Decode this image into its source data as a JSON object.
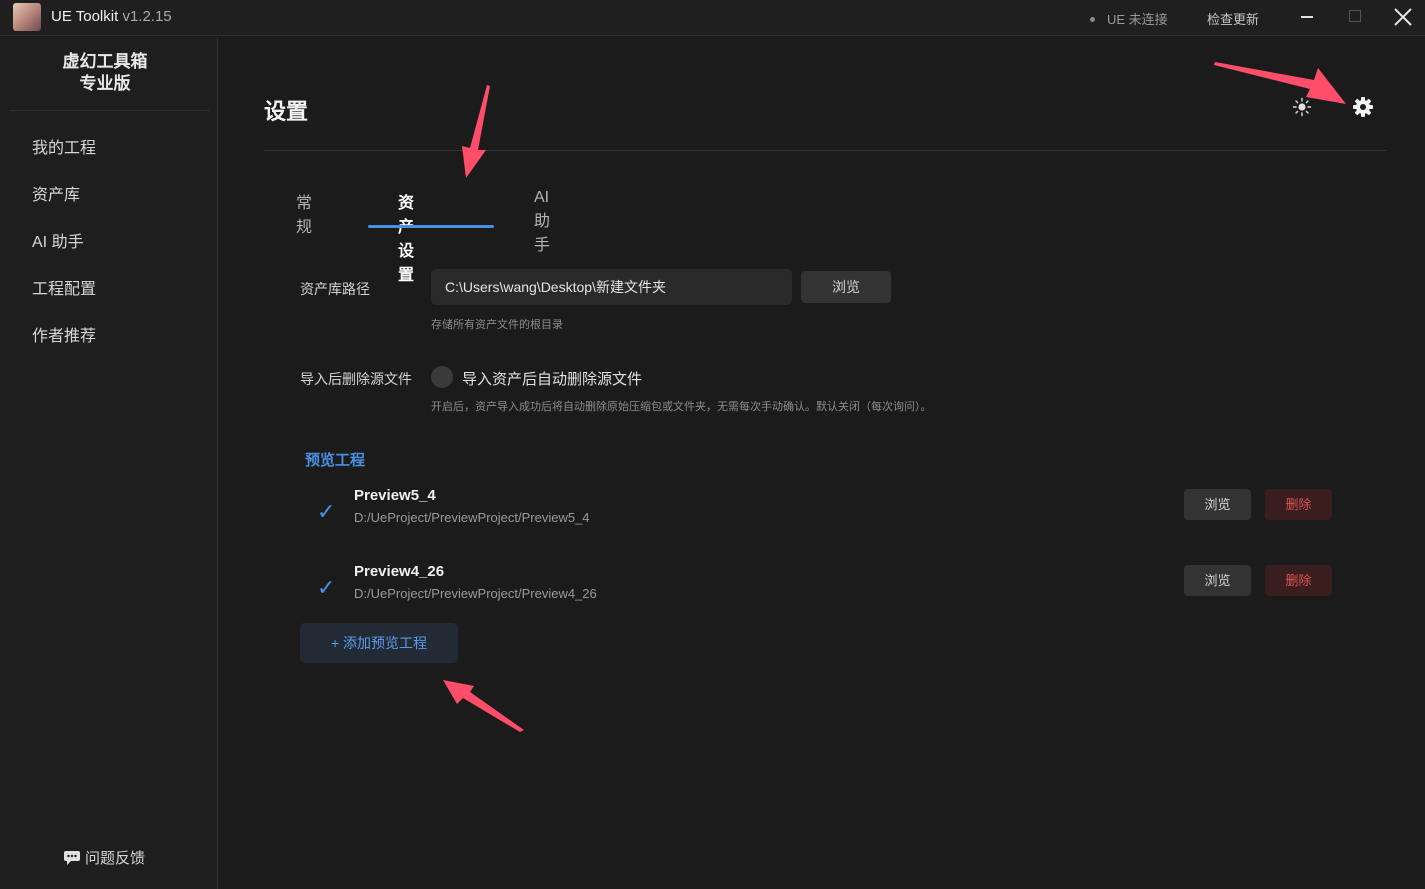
{
  "titlebar": {
    "app_name": "UE Toolkit",
    "version": "v1.2.15",
    "ue_status": "UE 未连接",
    "check_update": "检查更新"
  },
  "sidebar": {
    "brand_line1": "虚幻工具箱",
    "brand_line2": "专业版",
    "items": [
      {
        "label": "我的工程"
      },
      {
        "label": "资产库"
      },
      {
        "label": "AI 助手"
      },
      {
        "label": "工程配置"
      },
      {
        "label": "作者推荐"
      }
    ],
    "feedback": "问题反馈"
  },
  "page": {
    "title": "设置",
    "tabs": [
      {
        "label": "常规"
      },
      {
        "label": "资产设置",
        "active": true
      },
      {
        "label": "AI助手"
      }
    ]
  },
  "asset_settings": {
    "library_path_label": "资产库路径",
    "library_path_value": "C:\\Users\\wang\\Desktop\\新建文件夹",
    "browse_label": "浏览",
    "library_path_hint": "存储所有资产文件的根目录",
    "delete_source_label": "导入后删除源文件",
    "delete_source_toggle_label": "导入资产后自动删除源文件",
    "delete_source_enabled": false,
    "delete_source_hint": "开启后，资产导入成功后将自动删除原始压缩包或文件夹，无需每次手动确认。默认关闭（每次询问）。"
  },
  "preview_projects": {
    "section_title": "预览工程",
    "browse_label": "浏览",
    "delete_label": "删除",
    "add_label": "+ 添加预览工程",
    "items": [
      {
        "name": "Preview5_4",
        "path": "D:/UeProject/PreviewProject/Preview5_4",
        "checked": true
      },
      {
        "name": "Preview4_26",
        "path": "D:/UeProject/PreviewProject/Preview4_26",
        "checked": true
      }
    ]
  },
  "colors": {
    "accent": "#4a90e2",
    "danger": "#d9534f",
    "annotation_arrow": "#ff4d6a",
    "background": "#1b1b1b"
  },
  "icons": {
    "app": "app-avatar-icon",
    "theme": "sun-icon",
    "settings": "gear-icon",
    "feedback": "chat-icon",
    "check": "checkmark-icon"
  }
}
